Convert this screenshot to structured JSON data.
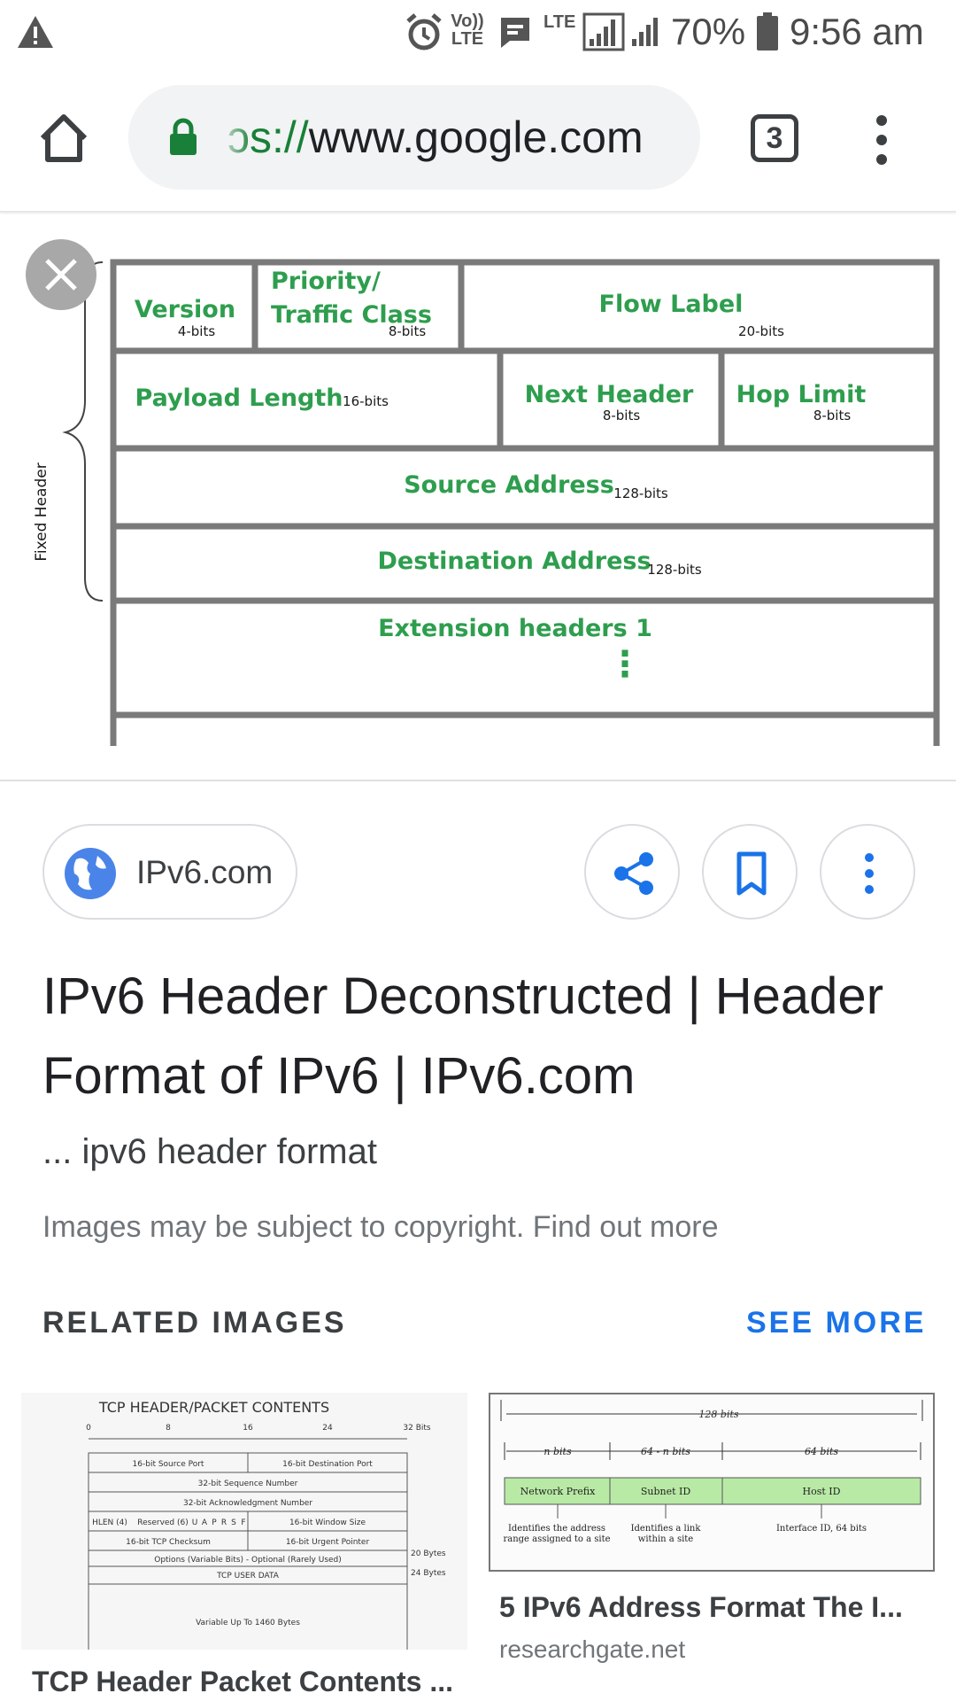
{
  "status_bar": {
    "battery": "70%",
    "time": "9:56 am",
    "volte_label": "Vo)) LTE",
    "lte_label": "LTE",
    "icons": [
      "warning-icon",
      "alarm-icon",
      "message-icon",
      "signal-icon",
      "battery-icon"
    ]
  },
  "browser": {
    "url_scheme": "ɔs://",
    "url_host": "www.google.com",
    "tab_count": "3",
    "icons": [
      "home-icon",
      "lock-icon",
      "menu-icon"
    ]
  },
  "viewer": {
    "diagram": {
      "side_label": "Fixed Header",
      "version": "Version",
      "version_bits": "4-bits",
      "priority_line1": "Priority/",
      "priority_line2": "Traffic Class",
      "priority_bits": "8-bits",
      "flow_label": "Flow Label",
      "flow_bits": "20-bits",
      "payload": "Payload Length",
      "payload_bits": "16-bits",
      "next_header": "Next Header",
      "next_bits": "8-bits",
      "hop_limit": "Hop Limit",
      "hop_bits": "8-bits",
      "source": "Source Address",
      "source_bits": "128-bits",
      "destination": "Destination Address",
      "destination_bits": "128-bits",
      "extension": "Extension headers 1",
      "ellipsis": "⋮"
    }
  },
  "result": {
    "source_name": "IPv6.com",
    "title": "IPv6 Header Deconstructed | Header Format of IPv6 | IPv6.com",
    "snippet": "... ipv6 header format",
    "copyright_text": "Images may be subject to copyright.",
    "find_out_more": "Find out more",
    "actions": [
      "share-icon",
      "bookmark-icon",
      "more-vert-icon"
    ]
  },
  "related": {
    "heading": "RELATED IMAGES",
    "see_more": "SEE MORE",
    "items": [
      {
        "caption": "TCP Header Packet Contents ...",
        "source": "",
        "thumb": {
          "title": "TCP HEADER/PACKET CONTENTS",
          "bit_marks": [
            "0",
            "8",
            "16",
            "24",
            "32 Bits"
          ],
          "rows": [
            "16-bit Source Port",
            "16-bit Destination Port",
            "32-bit Sequence Number",
            "32-bit Acknowledgment Number",
            "HLEN (4)",
            "Reserved (6)",
            "U",
            "A",
            "P",
            "R",
            "S",
            "F",
            "16-bit Window Size",
            "16-bit TCP Checksum",
            "16-bit Urgent Pointer",
            "Options (Variable Bits) - Optional (Rarely Used)",
            "TCP USER DATA",
            "Variable Up To 1460 Bytes"
          ],
          "side": [
            "20 Bytes",
            "24 Bytes"
          ]
        }
      },
      {
        "caption": "5 IPv6 Address Format The I...",
        "source": "researchgate.net",
        "thumb": {
          "total": "128 bits",
          "n": "n bits",
          "mid": "64 - n bits",
          "right": "64 bits",
          "cells": [
            "Network Prefix",
            "Subnet ID",
            "Host ID"
          ],
          "desc1": "Identifies the address range assigned to a site",
          "desc2": "Identifies a link within a site",
          "desc3": "Interface ID, 64 bits"
        }
      }
    ]
  }
}
